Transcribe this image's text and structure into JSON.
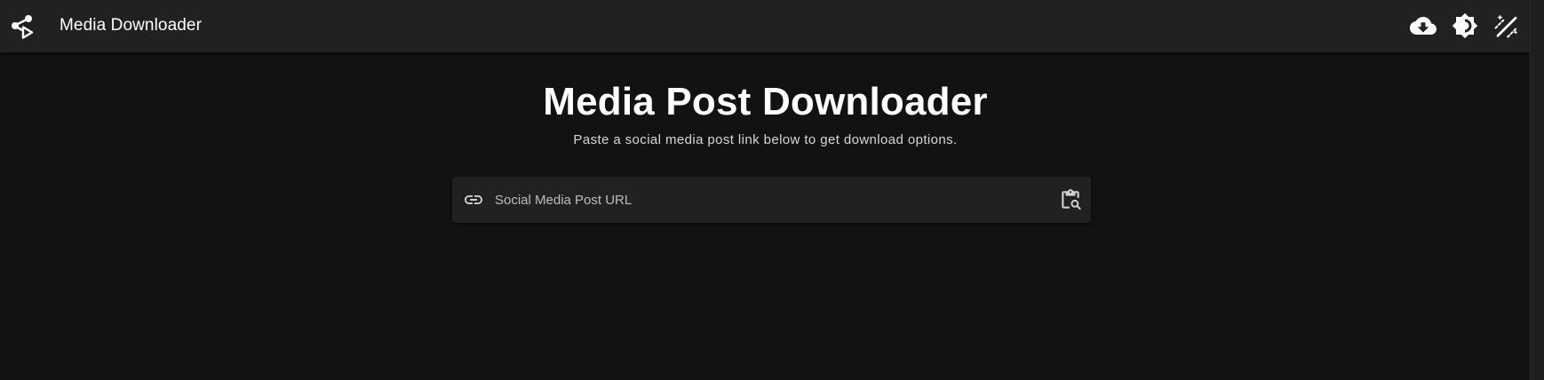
{
  "app_bar": {
    "logo_icon": "share-play-icon",
    "title": "Media Downloader",
    "actions": [
      {
        "icon": "cloud-download-icon"
      },
      {
        "icon": "brightness-contrast-icon"
      },
      {
        "icon": "auto-fix-magic-icon"
      }
    ],
    "colors": {
      "background": "#212121",
      "foreground": "#ffffff"
    }
  },
  "main": {
    "title": "Media Post Downloader",
    "subtitle": "Paste a social media post link below to get download options.",
    "url_field": {
      "leading_icon": "link-icon",
      "placeholder": "Social Media Post URL",
      "value": "",
      "trailing_icon": "content-paste-search-icon"
    }
  },
  "theme": {
    "page_background": "#121212",
    "surface": "#212121",
    "text_secondary": "#d6d6d6"
  }
}
